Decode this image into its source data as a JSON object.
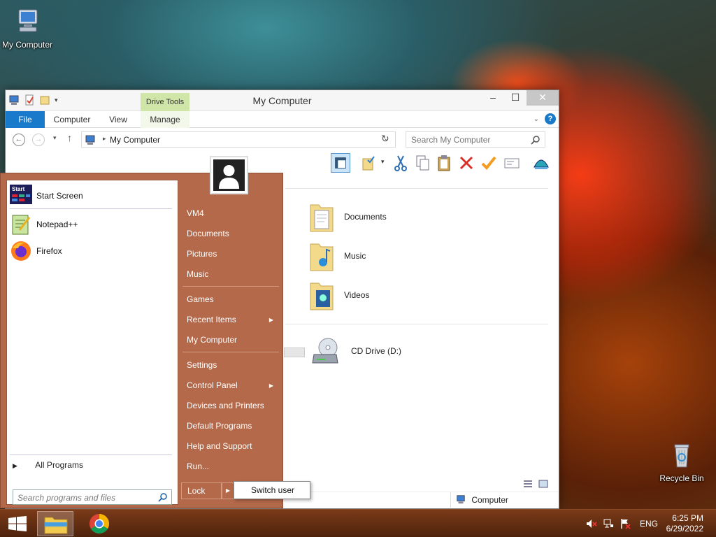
{
  "desktop": {
    "icons": [
      {
        "label": "My Computer",
        "icon": "computer-icon"
      },
      {
        "label": "Recycle Bin",
        "icon": "recycle-bin-icon"
      }
    ]
  },
  "window": {
    "title": "My Computer",
    "context_tab": "Drive Tools",
    "tabs": {
      "file": "File",
      "computer": "Computer",
      "view": "View",
      "manage": "Manage"
    },
    "address": "My Computer",
    "search_placeholder": "Search My Computer",
    "folders": [
      {
        "label": "Documents",
        "icon": "documents-folder-icon"
      },
      {
        "label": "Music",
        "icon": "music-folder-icon"
      },
      {
        "label": "Videos",
        "icon": "videos-folder-icon"
      }
    ],
    "drives": [
      {
        "label": "CD Drive (D:)",
        "icon": "cd-drive-icon"
      }
    ],
    "status": {
      "location": "Computer"
    }
  },
  "start_menu": {
    "pinned": [
      {
        "label": "Start Screen",
        "icon": "start-screen-icon"
      },
      {
        "label": "Notepad++",
        "icon": "notepad-plus-plus-icon"
      },
      {
        "label": "Firefox",
        "icon": "firefox-icon"
      }
    ],
    "all_programs": "All Programs",
    "search_placeholder": "Search programs and files",
    "right_items": {
      "user": "VM4",
      "documents": "Documents",
      "pictures": "Pictures",
      "music": "Music",
      "games": "Games",
      "recent_items": "Recent Items",
      "my_computer": "My Computer",
      "settings": "Settings",
      "control_panel": "Control Panel",
      "devices_printers": "Devices and Printers",
      "default_programs": "Default Programs",
      "help_support": "Help and Support",
      "run": "Run..."
    },
    "lock": "Lock",
    "switch_user": "Switch user"
  },
  "taskbar": {
    "language": "ENG",
    "time": "6:25 PM",
    "date": "6/29/2022"
  },
  "colors": {
    "start_menu_bg": "#b4694a",
    "file_tab": "#1979ca",
    "drive_tools_bg": "#cfe6a8",
    "taskbar_bg": "#5e2a10"
  }
}
